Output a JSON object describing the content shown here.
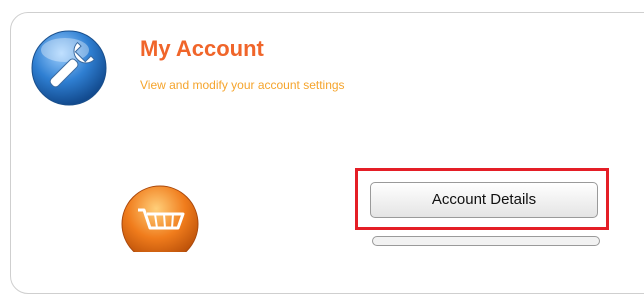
{
  "header": {
    "title": "My Account",
    "subtitle": "View and modify your account settings",
    "icon": "wrench-icon"
  },
  "sections": [
    {
      "icon": "shopping-cart-icon",
      "button_label": "Account Details",
      "highlighted": true
    }
  ],
  "colors": {
    "title": "#f0652a",
    "subtitle": "#f5a42c",
    "highlight": "#e41e26",
    "icon_blue": "#2f7fd2",
    "icon_orange": "#f07c1c"
  }
}
